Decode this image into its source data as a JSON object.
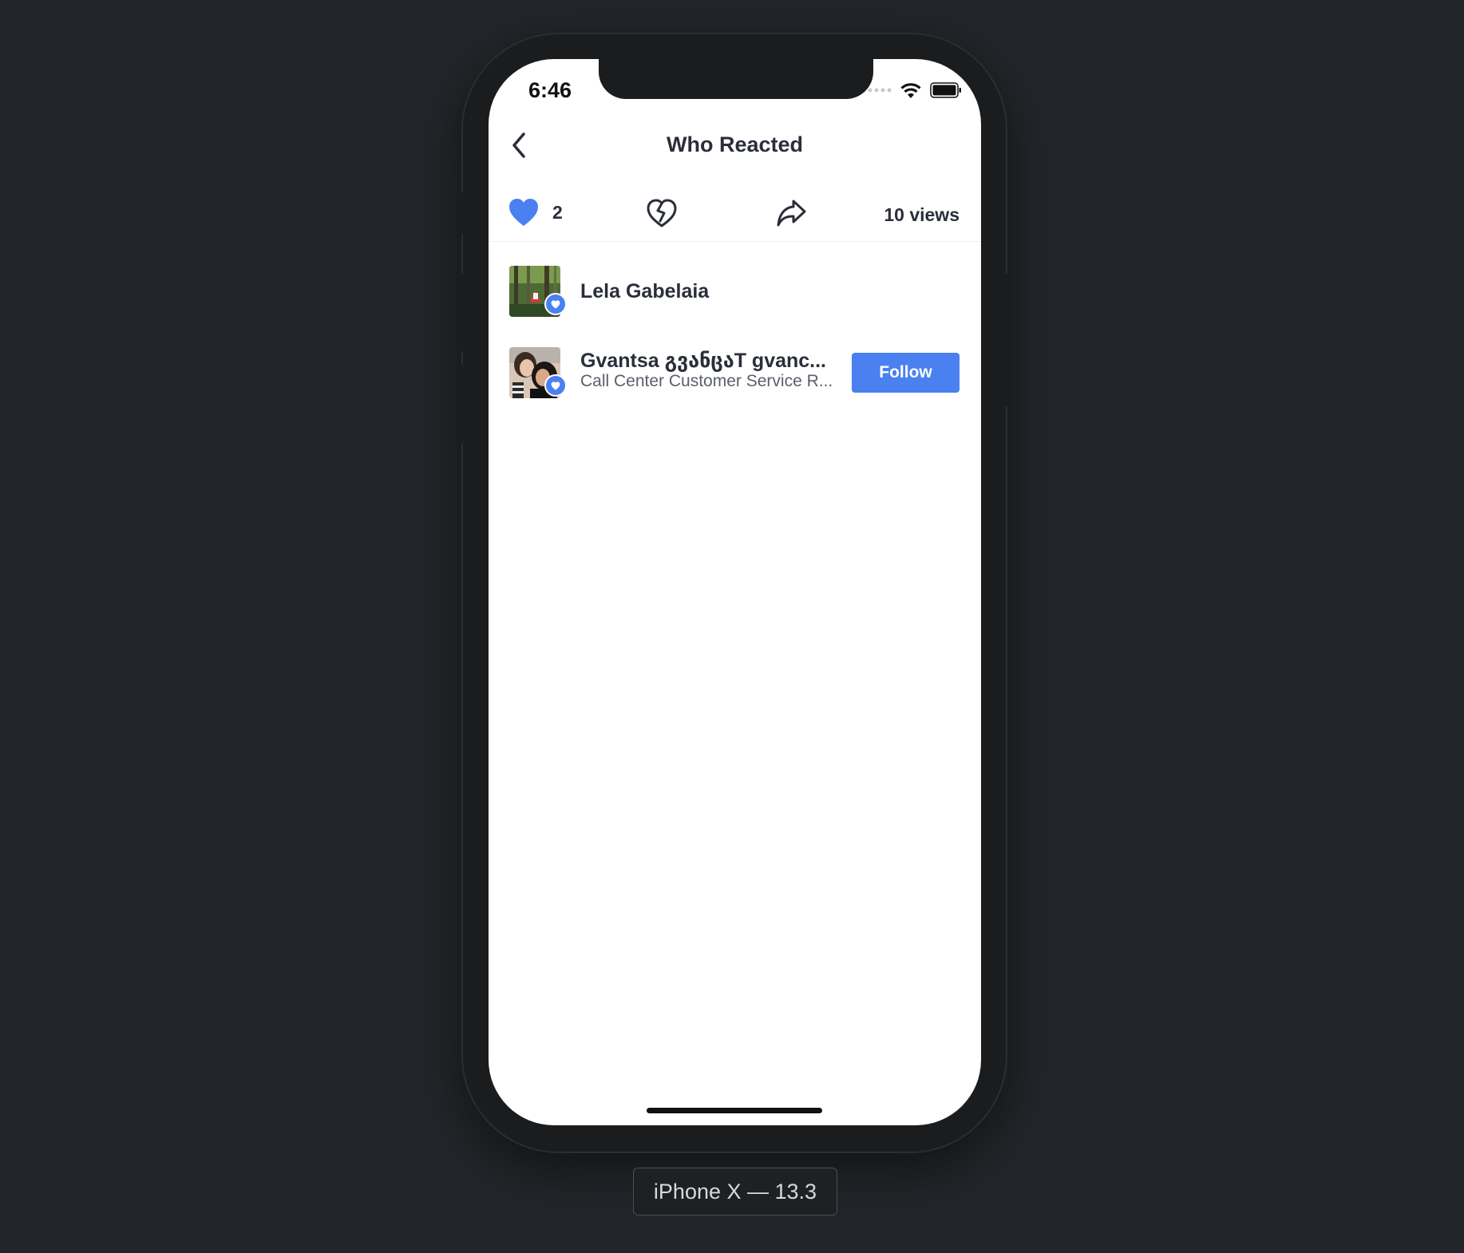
{
  "status_bar": {
    "time": "6:46"
  },
  "nav": {
    "title": "Who Reacted"
  },
  "reactions": {
    "like_count": "2",
    "views": "10 views"
  },
  "reactors": [
    {
      "name": "Lela Gabelaia",
      "subtitle": "",
      "follow_label": ""
    },
    {
      "name": "Gvantsa გვანცაT gvanc...",
      "subtitle": "Call Center Customer Service R...",
      "follow_label": "Follow"
    }
  ],
  "simulator": {
    "label": "iPhone X — 13.3"
  },
  "colors": {
    "accent": "#4a80f0",
    "text": "#2a2e3a",
    "background": "#222529"
  }
}
